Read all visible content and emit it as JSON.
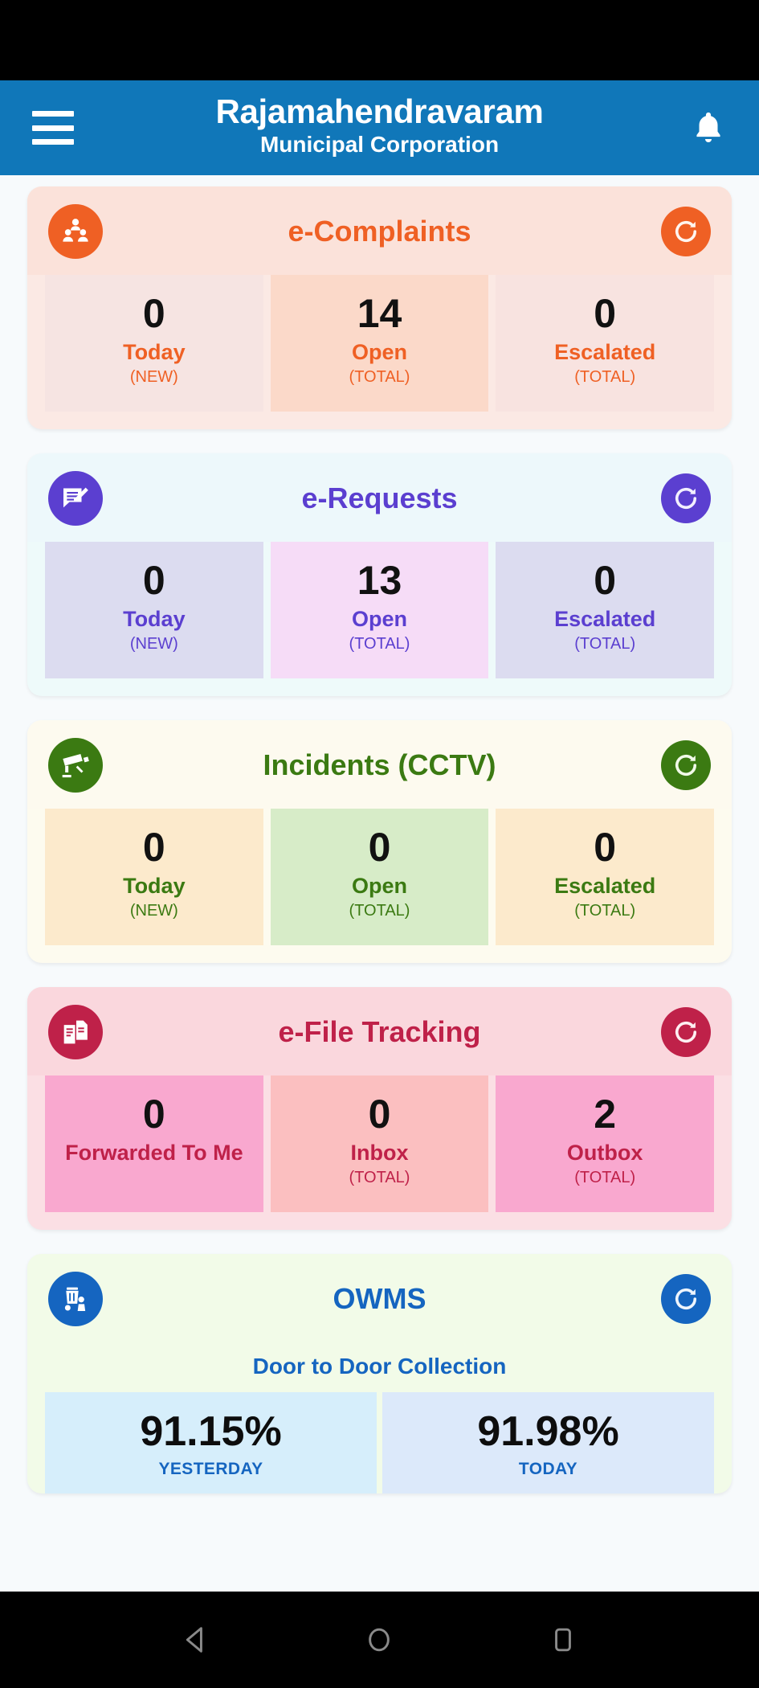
{
  "statusbar": {
    "present": true
  },
  "appbar": {
    "menu_icon": "hamburger-menu-icon",
    "title": "Rajamahendravaram",
    "subtitle": "Municipal Corporation",
    "bell_icon": "notification-bell-icon",
    "bg_color": "#1077b9"
  },
  "cards": [
    {
      "id": "e-complaints",
      "title": "e-Complaints",
      "icon": "people-group-icon",
      "refresh_icon": "refresh-icon",
      "accent": "#ef6024",
      "card_bg": "#fbe9e4",
      "head_bg": "#fbe2da",
      "stats": [
        {
          "value": "0",
          "label": "Today",
          "sub": "(NEW)",
          "bg": "#f6e4e2"
        },
        {
          "value": "14",
          "label": "Open",
          "sub": "(TOTAL)",
          "bg": "#fbd9c9"
        },
        {
          "value": "0",
          "label": "Escalated",
          "sub": "(TOTAL)",
          "bg": "#f8e3e0"
        }
      ]
    },
    {
      "id": "e-requests",
      "title": "e-Requests",
      "icon": "document-edit-icon",
      "refresh_icon": "refresh-icon",
      "accent": "#5b3fd0",
      "card_bg": "#eefafa",
      "head_bg": "#edf8fb",
      "stats": [
        {
          "value": "0",
          "label": "Today",
          "sub": "(NEW)",
          "bg": "#dcdcf0"
        },
        {
          "value": "13",
          "label": "Open",
          "sub": "(TOTAL)",
          "bg": "#f6dcf7"
        },
        {
          "value": "0",
          "label": "Escalated",
          "sub": "(TOTAL)",
          "bg": "#dcdcf0"
        }
      ]
    },
    {
      "id": "incidents-cctv",
      "title": "Incidents (CCTV)",
      "icon": "cctv-camera-icon",
      "refresh_icon": "refresh-icon",
      "accent": "#3b7a12",
      "card_bg": "#fdfbef",
      "head_bg": "#fdfaef",
      "stats": [
        {
          "value": "0",
          "label": "Today",
          "sub": "(NEW)",
          "bg": "#fceacc"
        },
        {
          "value": "0",
          "label": "Open",
          "sub": "(TOTAL)",
          "bg": "#d7ecc8"
        },
        {
          "value": "0",
          "label": "Escalated",
          "sub": "(TOTAL)",
          "bg": "#fceacc"
        }
      ]
    },
    {
      "id": "e-file-tracking",
      "title": "e-File Tracking",
      "icon": "documents-stack-icon",
      "refresh_icon": "refresh-icon",
      "accent": "#bf2149",
      "card_bg": "#fbdfe4",
      "head_bg": "#fad7dd",
      "stats": [
        {
          "value": "0",
          "label": "Forwarded To Me",
          "sub": "",
          "bg": "#f9a8cf"
        },
        {
          "value": "0",
          "label": "Inbox",
          "sub": "(TOTAL)",
          "bg": "#fbbfc0"
        },
        {
          "value": "2",
          "label": "Outbox",
          "sub": "(TOTAL)",
          "bg": "#f9a8cf"
        }
      ]
    }
  ],
  "owms": {
    "id": "owms",
    "title": "OWMS",
    "icon": "waste-bin-icon",
    "refresh_icon": "refresh-icon",
    "accent": "#1565c0",
    "card_bg": "#f2fbe8",
    "head_bg": "#f2fbe8",
    "subtitle": "Door to Door Collection",
    "cells": [
      {
        "value": "91.15%",
        "when": "YESTERDAY",
        "bg": "#d6eefb"
      },
      {
        "value": "91.98%",
        "when": "TODAY",
        "bg": "#dce9fa"
      }
    ]
  },
  "navbar": {
    "back_icon": "back-triangle-icon",
    "home_icon": "home-circle-icon",
    "recents_icon": "recents-square-icon"
  }
}
